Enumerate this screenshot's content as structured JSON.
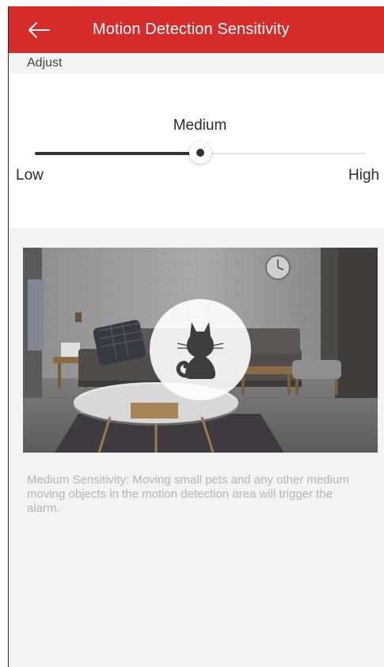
{
  "header": {
    "title": "Motion Detection Sensitivity",
    "background_color": "#d62b2b",
    "back_icon": "arrow-left-icon"
  },
  "section": {
    "label": "Adjust"
  },
  "sensitivity": {
    "current_label": "Medium",
    "level_fraction": 0.5,
    "min_label": "Low",
    "max_label": "High"
  },
  "preview": {
    "overlay_icon": "cat-icon"
  },
  "description": "Medium Sensitivity: Moving small pets and any other medium moving objects in the motion detection area will trigger the alarm."
}
